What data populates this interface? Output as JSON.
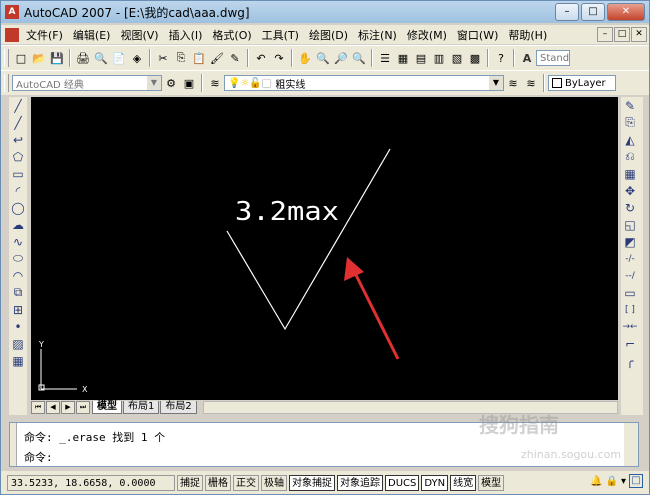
{
  "window": {
    "title": "AutoCAD 2007 - [E:\\我的cad\\aaa.dwg]",
    "app_icon": "A",
    "controls": [
      "minimize-icon",
      "maximize-icon",
      "close-icon"
    ],
    "control_glyphs": {
      "minimize": "–",
      "maximize": "□",
      "close": "✕"
    }
  },
  "menubar": {
    "items": [
      "文件(F)",
      "编辑(E)",
      "视图(V)",
      "插入(I)",
      "格式(O)",
      "工具(T)",
      "绘图(D)",
      "标注(N)",
      "修改(M)",
      "窗口(W)",
      "帮助(H)"
    ],
    "mdi_glyphs": [
      "–",
      "□",
      "✕"
    ]
  },
  "toolbar1": {
    "icons": [
      "new-icon",
      "open-icon",
      "save-icon",
      "plot-icon",
      "plot-preview-icon",
      "publish-icon",
      "3d-dwf-icon",
      "cut-icon",
      "copy-icon",
      "paste-icon",
      "match-properties-icon",
      "block-editor-icon",
      "undo-icon",
      "redo-icon",
      "pan-icon",
      "zoom-realtime-icon",
      "zoom-window-icon",
      "zoom-previous-icon",
      "properties-icon",
      "designcenter-icon",
      "tool-palettes-icon",
      "sheet-set-icon",
      "markup-icon",
      "calculator-icon",
      "help-icon"
    ],
    "glyphs": [
      "□",
      "📂",
      "💾",
      "🖨",
      "🔍",
      "📄",
      "◈",
      "✂",
      "⎘",
      "📋",
      "🖌",
      "✎",
      "↶",
      "↷",
      "✋",
      "🔍",
      "🔎",
      "🔍",
      "☰",
      "▦",
      "▤",
      "▥",
      "▧",
      "▩",
      "?"
    ],
    "text_style_label": "Stand"
  },
  "toolbar2": {
    "workspace": "AutoCAD 经典",
    "layer_label": "粗实线",
    "layer_icons": [
      "light-bulb-icon",
      "sun-icon",
      "lock-icon",
      "color-square-icon"
    ],
    "layer_glyphs": [
      "💡",
      "☼",
      "🔓",
      "■"
    ],
    "color_label": "ByLayer"
  },
  "left_toolbar": {
    "tools": [
      "line-icon",
      "construction-line-icon",
      "polyline-icon",
      "polygon-icon",
      "rectangle-icon",
      "arc-icon",
      "circle-icon",
      "revision-cloud-icon",
      "spline-icon",
      "ellipse-icon",
      "ellipse-arc-icon",
      "insert-block-icon",
      "make-block-icon",
      "point-icon",
      "hatch-icon",
      "gradient-icon"
    ],
    "glyphs": [
      "╱",
      "╱",
      "↩",
      "⬠",
      "▭",
      "◜",
      "◯",
      "☁",
      "∿",
      "⬭",
      "◠",
      "⧉",
      "⊞",
      "•",
      "▨",
      "▦"
    ]
  },
  "right_toolbar": {
    "tools": [
      "erase-icon",
      "copy-object-icon",
      "mirror-icon",
      "offset-icon",
      "array-icon",
      "move-icon",
      "rotate-icon",
      "scale-icon",
      "stretch-icon",
      "trim-icon",
      "extend-icon",
      "break-at-point-icon",
      "break-icon",
      "join-icon",
      "chamfer-icon",
      "fillet-icon"
    ],
    "glyphs": [
      "✎",
      "⎘",
      "◭",
      "⎌",
      "▦",
      "✥",
      "↻",
      "◱",
      "◩",
      "-/-",
      "--/",
      "▭",
      "[ ]",
      "→←",
      "⌐",
      "╭"
    ]
  },
  "drawing": {
    "annotation_text": "3.2max",
    "ucs_y_label": "Y",
    "ucs_x_label": "X",
    "bg_color": "#000000",
    "line_color": "#ffffff",
    "arrow_color": "#e03030"
  },
  "layout_tabs": {
    "nav_glyphs": [
      "⏮",
      "◀",
      "▶",
      "⏭"
    ],
    "tabs": [
      "模型",
      "布局1",
      "布局2"
    ],
    "active": "模型"
  },
  "command_line": {
    "line1": "命令: _.erase 找到 1 个",
    "line2": "命令:"
  },
  "statusbar": {
    "coordinates": "33.5233, 18.6658, 0.0000",
    "buttons": [
      "捕捉",
      "栅格",
      "正交",
      "极轴",
      "对象捕捉",
      "对象追踪",
      "DUCS",
      "DYN",
      "线宽",
      "模型"
    ],
    "buttons_on": [
      "对象捕捉",
      "对象追踪",
      "DUCS",
      "DYN",
      "线宽"
    ],
    "tray_glyphs": [
      "🔔",
      "🔒",
      "▾",
      "□"
    ]
  },
  "watermark": {
    "text": "搜狗指南",
    "url": "zhinan.sogou.com"
  }
}
